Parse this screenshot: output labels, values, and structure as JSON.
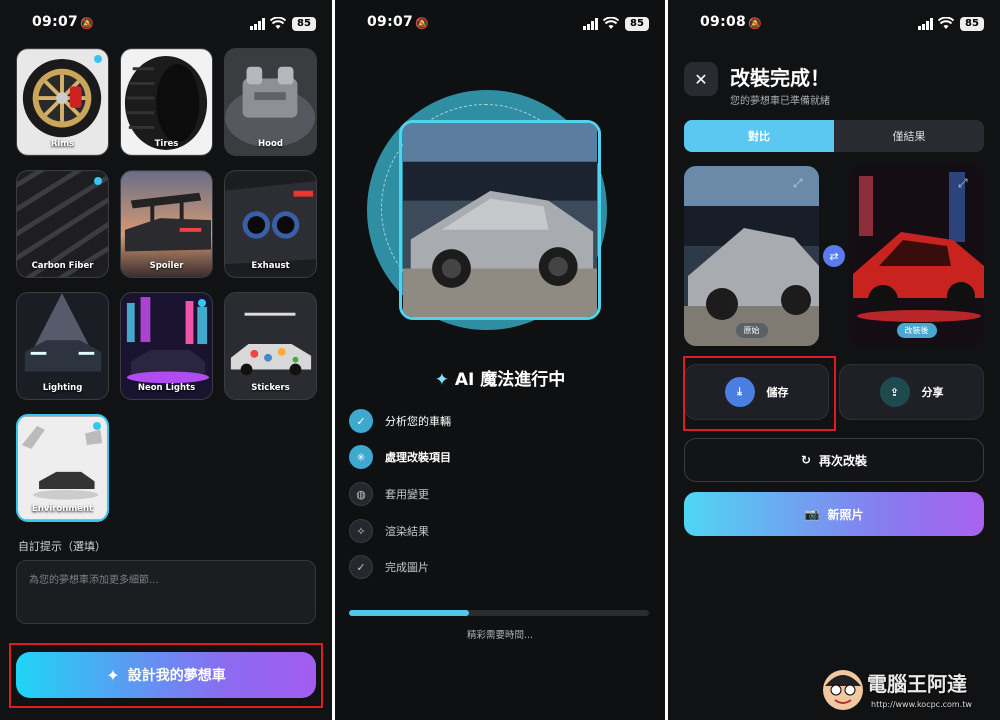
{
  "screen1": {
    "status": {
      "time": "09:07",
      "battery": "85"
    },
    "tiles": [
      {
        "label": "Rims",
        "dot": true
      },
      {
        "label": "Tires",
        "dot": false
      },
      {
        "label": "Hood",
        "dot": false
      },
      {
        "label": "Carbon Fiber",
        "dot": true
      },
      {
        "label": "Spoiler",
        "dot": false
      },
      {
        "label": "Exhaust",
        "dot": false
      },
      {
        "label": "Lighting",
        "dot": false
      },
      {
        "label": "Neon Lights",
        "dot": true
      },
      {
        "label": "Stickers",
        "dot": false
      },
      {
        "label": "Environment",
        "dot": true,
        "selected": true
      }
    ],
    "custom_prompt_label": "自訂提示（選填）",
    "custom_prompt_placeholder": "為您的夢想車添加更多細節...",
    "design_button": "設計我的夢想車"
  },
  "screen2": {
    "status": {
      "time": "09:07",
      "battery": "85"
    },
    "title": "AI 魔法進行中",
    "steps": [
      {
        "label": "分析您的車輛",
        "state": "done"
      },
      {
        "label": "處理改裝項目",
        "state": "active"
      },
      {
        "label": "套用變更",
        "state": "pending"
      },
      {
        "label": "渲染結果",
        "state": "pending"
      },
      {
        "label": "完成圖片",
        "state": "pending"
      }
    ],
    "progress": 0.4,
    "wait_text": "精彩需要時間..."
  },
  "screen3": {
    "status": {
      "time": "09:08",
      "battery": "85"
    },
    "title": "改裝完成！",
    "subtitle": "您的夢想車已準備就緒",
    "segments": [
      "對比",
      "僅結果"
    ],
    "original_tag": "原始",
    "modified_tag": "改裝後",
    "save_label": "儲存",
    "share_label": "分享",
    "redo_label": "再次改裝",
    "new_photo_label": "新照片"
  },
  "watermark": {
    "text": "電腦王阿達",
    "url": "http://www.kocpc.com.tw"
  },
  "colors": {
    "accent": "#34c6f0",
    "highlight_box": "#e11b22",
    "background": "#111214"
  }
}
